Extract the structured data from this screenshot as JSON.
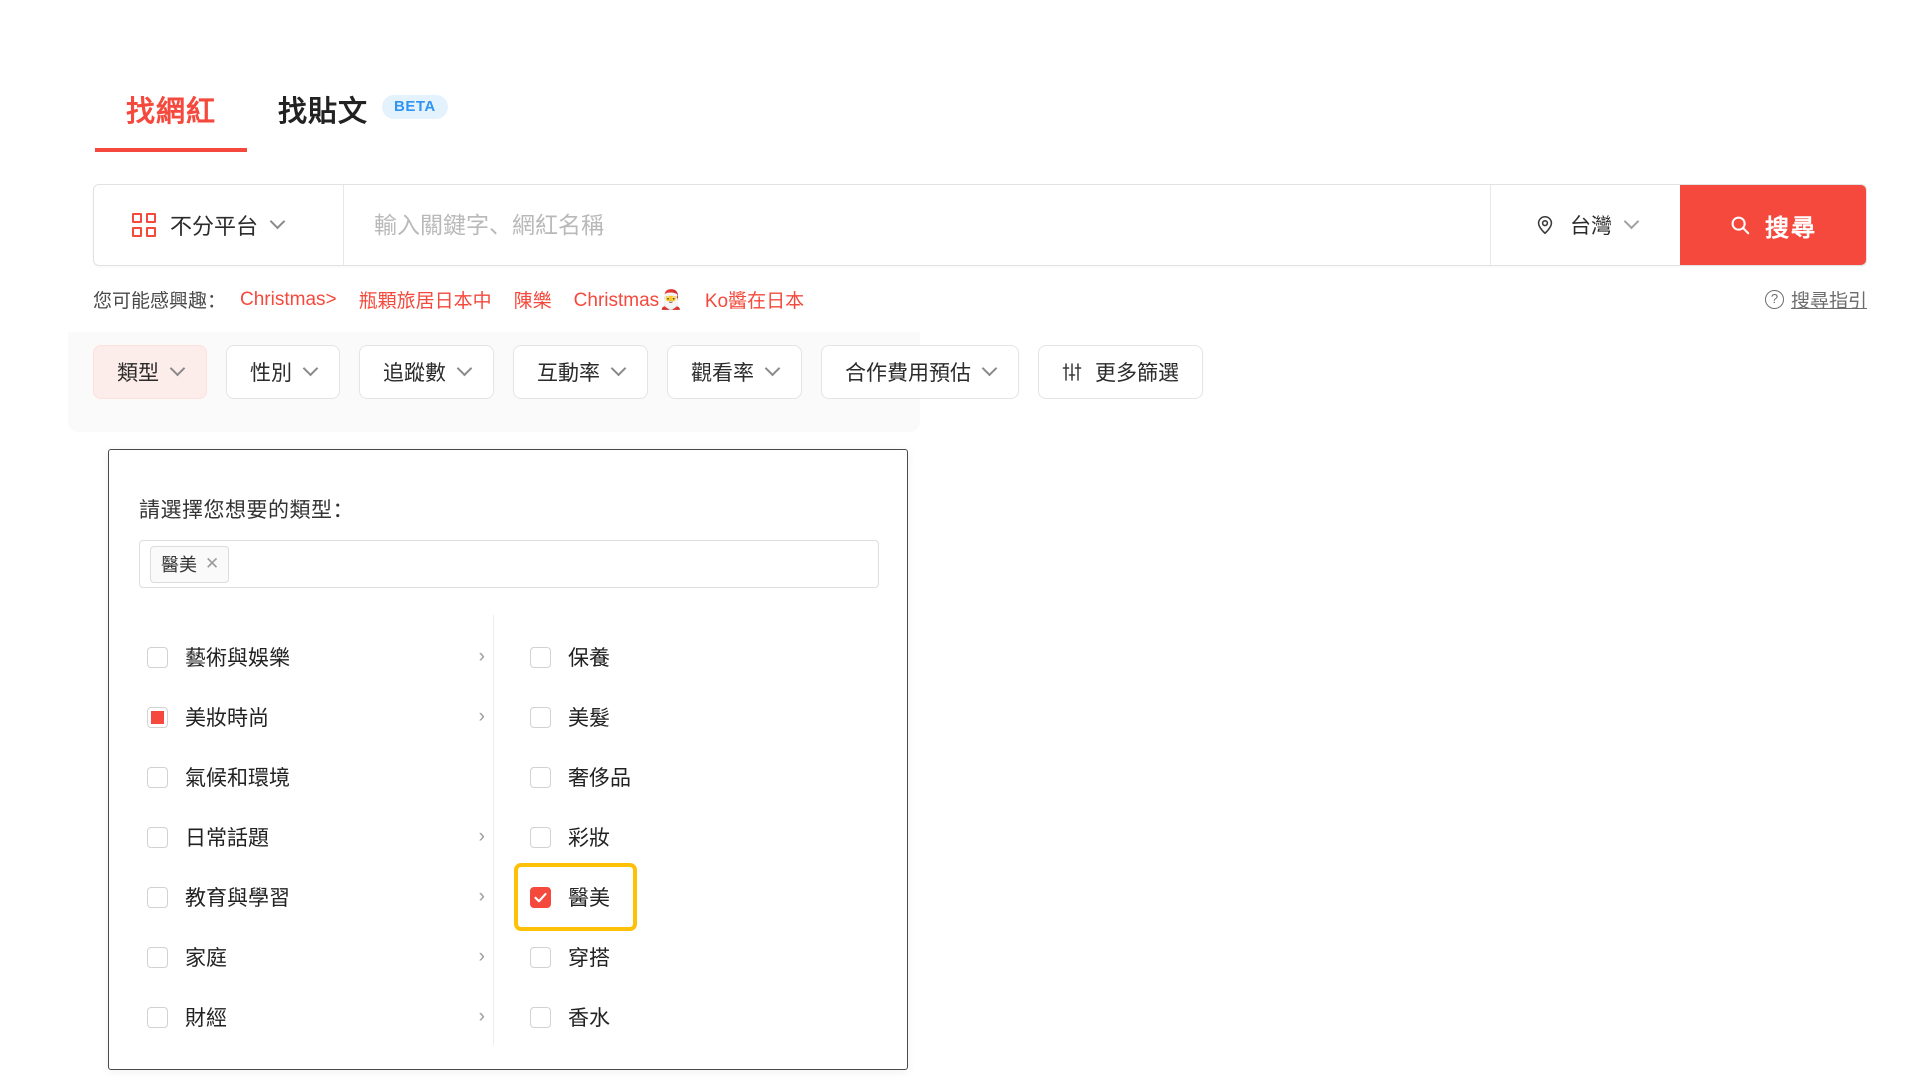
{
  "tabs": [
    {
      "label": "找網紅",
      "active": true,
      "badge": null
    },
    {
      "label": "找貼文",
      "active": false,
      "badge": "BETA"
    }
  ],
  "search": {
    "platform_label": "不分平台",
    "platform_icon": "grid-icon",
    "placeholder": "輸入關鍵字、網紅名稱",
    "value": "",
    "region_label": "台灣",
    "region_icon": "location-pin-icon",
    "button_label": "搜尋",
    "button_icon": "search-icon",
    "button_color": "#F4493C"
  },
  "suggestions": {
    "label": "您可能感興趣：",
    "items": [
      "Christmas>",
      "瓶顆旅居日本中",
      "陳樂",
      "Christmas🎅",
      "Ko醬在日本"
    ],
    "guide_link": "搜尋指引"
  },
  "filters": [
    {
      "label": "類型",
      "active": true,
      "has_chevron": true
    },
    {
      "label": "性別",
      "active": false,
      "has_chevron": true
    },
    {
      "label": "追蹤數",
      "active": false,
      "has_chevron": true
    },
    {
      "label": "互動率",
      "active": false,
      "has_chevron": true
    },
    {
      "label": "觀看率",
      "active": false,
      "has_chevron": true
    },
    {
      "label": "合作費用預估",
      "active": false,
      "has_chevron": true
    },
    {
      "label": "更多篩選",
      "active": false,
      "has_chevron": false,
      "icon": "sliders-icon"
    }
  ],
  "type_panel": {
    "title": "請選擇您想要的類型：",
    "selected_tags": [
      {
        "label": "醫美",
        "remove_icon": "close-icon"
      }
    ],
    "left_options": [
      {
        "label": "藝術與娛樂",
        "state": "unchecked",
        "has_arrow": true
      },
      {
        "label": "美妝時尚",
        "state": "indeterminate",
        "has_arrow": true
      },
      {
        "label": "氣候和環境",
        "state": "unchecked",
        "has_arrow": false
      },
      {
        "label": "日常話題",
        "state": "unchecked",
        "has_arrow": true
      },
      {
        "label": "教育與學習",
        "state": "unchecked",
        "has_arrow": true
      },
      {
        "label": "家庭",
        "state": "unchecked",
        "has_arrow": true
      },
      {
        "label": "財經",
        "state": "unchecked",
        "has_arrow": true
      }
    ],
    "right_options": [
      {
        "label": "保養",
        "state": "unchecked",
        "highlighted": false
      },
      {
        "label": "美髮",
        "state": "unchecked",
        "highlighted": false
      },
      {
        "label": "奢侈品",
        "state": "unchecked",
        "highlighted": false
      },
      {
        "label": "彩妝",
        "state": "unchecked",
        "highlighted": false
      },
      {
        "label": "醫美",
        "state": "checked",
        "highlighted": true
      },
      {
        "label": "穿搭",
        "state": "unchecked",
        "highlighted": false
      },
      {
        "label": "香水",
        "state": "unchecked",
        "highlighted": false
      }
    ],
    "arrow_glyph": "›",
    "highlight_color": "#FFC107"
  },
  "colors": {
    "accent": "#F4493C",
    "accent_soft": "#FDEDEA",
    "beta_bg": "#E4F2FE",
    "beta_fg": "#2F95F1"
  }
}
